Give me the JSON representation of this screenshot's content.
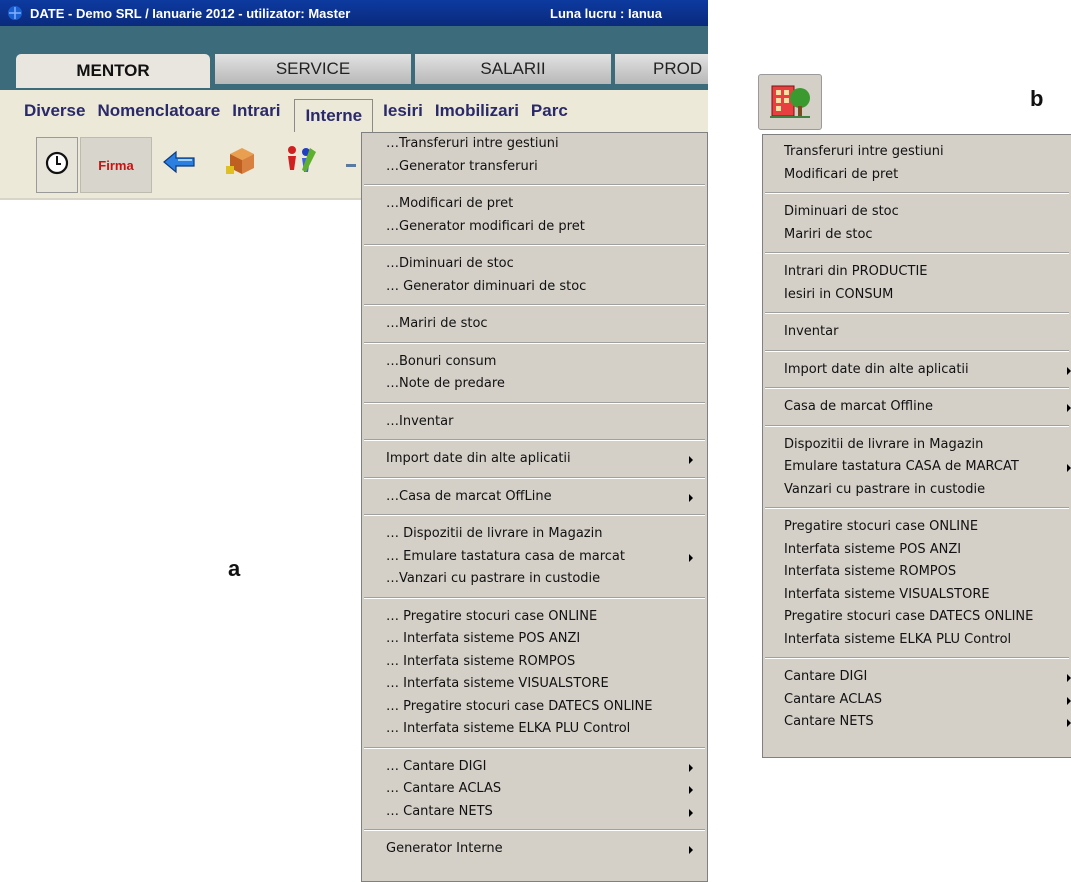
{
  "window": {
    "title": "DATE - Demo SRL / Ianuarie 2012 - utilizator: Master",
    "luna_lucru": "Luna lucru : Ianua"
  },
  "tabs": [
    "MENTOR",
    "SERVICE",
    "SALARII",
    "PROD"
  ],
  "menubar": [
    "Diverse",
    "Nomenclatoare",
    "Intrari",
    "Interne",
    "Iesiri",
    "Imobilizari",
    "Parc"
  ],
  "toolbar": {
    "firma_label": "Firma"
  },
  "labels": {
    "a": "a",
    "b": "b"
  },
  "menu_a": [
    {
      "label": "…Transferuri intre gestiuni"
    },
    {
      "label": "…Generator transferuri"
    },
    {
      "sep": true
    },
    {
      "label": "…Modificari de pret"
    },
    {
      "label": "…Generator modificari de pret"
    },
    {
      "sep": true
    },
    {
      "label": "…Diminuari de stoc"
    },
    {
      "label": "… Generator diminuari de stoc"
    },
    {
      "sep": true
    },
    {
      "label": "…Mariri de stoc"
    },
    {
      "sep": true
    },
    {
      "label": "…Bonuri consum"
    },
    {
      "label": "…Note de predare"
    },
    {
      "sep": true
    },
    {
      "label": "…Inventar"
    },
    {
      "sep": true
    },
    {
      "label": "Import date din alte aplicatii",
      "submenu": true
    },
    {
      "sep": true
    },
    {
      "label": "…Casa de marcat OffLine",
      "submenu": true
    },
    {
      "sep": true
    },
    {
      "label": "… Dispozitii de livrare in Magazin"
    },
    {
      "label": "… Emulare tastatura casa de marcat",
      "submenu": true
    },
    {
      "label": "…Vanzari cu pastrare in custodie"
    },
    {
      "sep": true
    },
    {
      "label": "… Pregatire stocuri case ONLINE"
    },
    {
      "label": "… Interfata sisteme POS ANZI"
    },
    {
      "label": "… Interfata sisteme ROMPOS"
    },
    {
      "label": "… Interfata sisteme VISUALSTORE"
    },
    {
      "label": "… Pregatire stocuri case DATECS ONLINE"
    },
    {
      "label": "… Interfata sisteme ELKA PLU Control"
    },
    {
      "sep": true
    },
    {
      "label": "… Cantare DIGI",
      "submenu": true
    },
    {
      "label": "… Cantare ACLAS",
      "submenu": true
    },
    {
      "label": "… Cantare NETS",
      "submenu": true
    },
    {
      "sep": true
    },
    {
      "label": "Generator Interne",
      "submenu": true
    }
  ],
  "menu_b": [
    {
      "label": "Transferuri intre gestiuni"
    },
    {
      "label": "Modificari de pret"
    },
    {
      "sep": true
    },
    {
      "label": "Diminuari de stoc"
    },
    {
      "label": "Mariri de stoc"
    },
    {
      "sep": true
    },
    {
      "label": "Intrari din PRODUCTIE"
    },
    {
      "label": "Iesiri in CONSUM"
    },
    {
      "sep": true
    },
    {
      "label": "Inventar"
    },
    {
      "sep": true
    },
    {
      "label": "Import date din alte aplicatii",
      "submenu": true
    },
    {
      "sep": true
    },
    {
      "label": "Casa de marcat Offline",
      "submenu": true
    },
    {
      "sep": true
    },
    {
      "label": "Dispozitii de livrare in Magazin"
    },
    {
      "label": "Emulare tastatura CASA de MARCAT",
      "submenu": true
    },
    {
      "label": "Vanzari cu pastrare in custodie"
    },
    {
      "sep": true
    },
    {
      "label": "Pregatire stocuri case ONLINE"
    },
    {
      "label": "Interfata sisteme POS ANZI"
    },
    {
      "label": "Interfata sisteme ROMPOS"
    },
    {
      "label": "Interfata sisteme VISUALSTORE"
    },
    {
      "label": "Pregatire stocuri case DATECS ONLINE"
    },
    {
      "label": "Interfata sisteme ELKA PLU Control"
    },
    {
      "sep": true
    },
    {
      "label": "Cantare DIGI",
      "submenu": true
    },
    {
      "label": "Cantare ACLAS",
      "submenu": true
    },
    {
      "label": "Cantare NETS",
      "submenu": true
    }
  ],
  "icons": [
    "app-logo-icon",
    "clock-icon",
    "arrow-icon",
    "boxes-icon",
    "people-icon",
    "building-tree-icon"
  ]
}
